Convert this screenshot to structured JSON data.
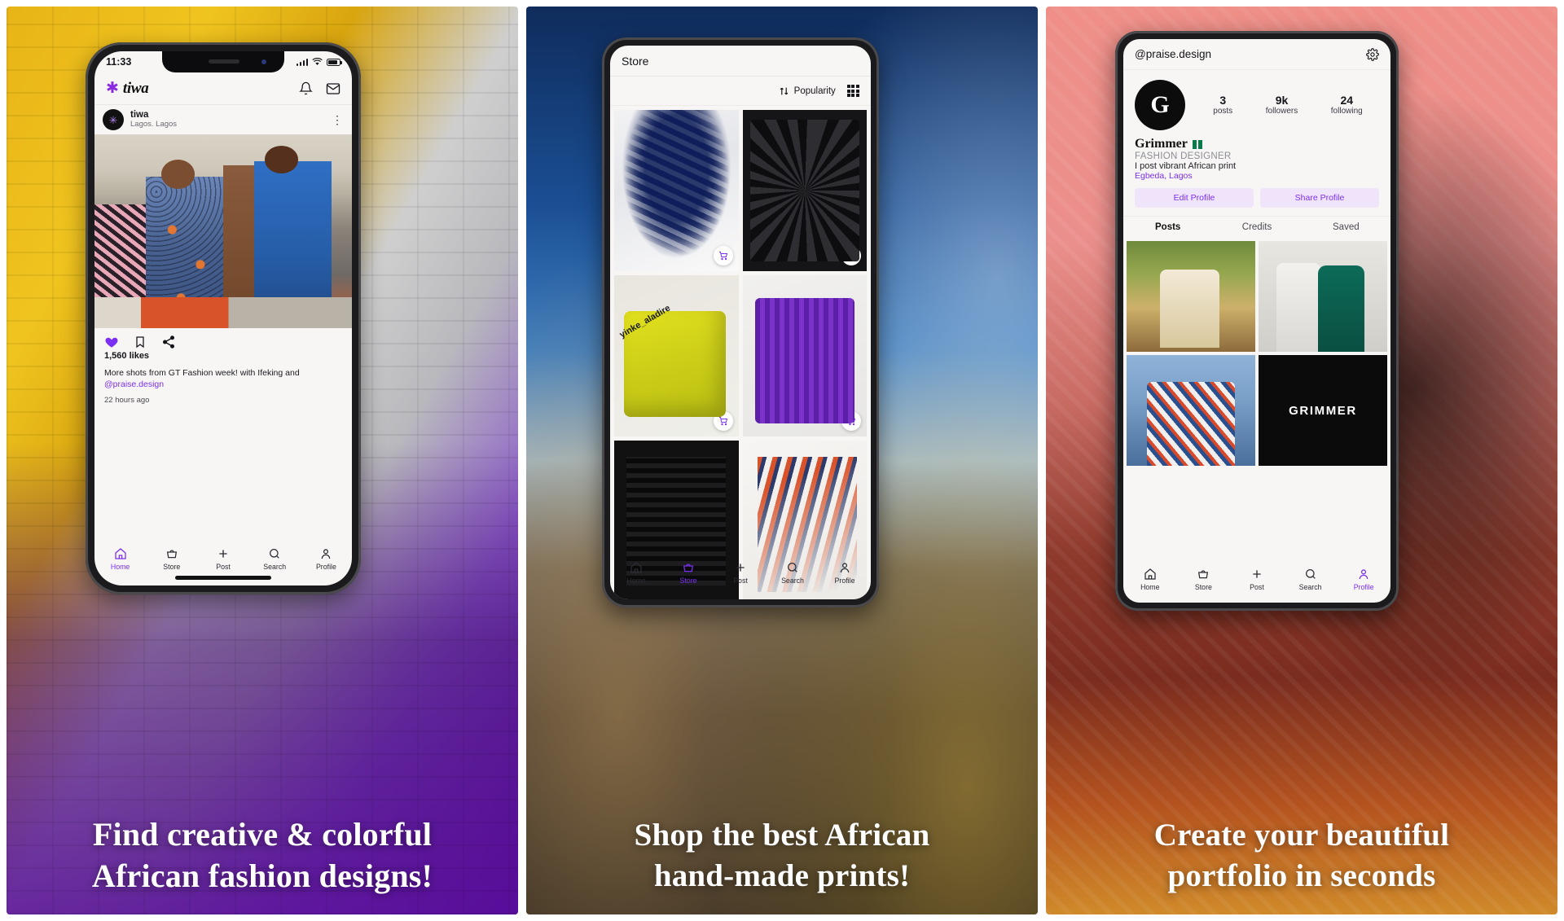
{
  "app": {
    "name": "tiwa",
    "brand_color": "#7b2ff2"
  },
  "panels": [
    {
      "caption_line1": "Find creative & colorful",
      "caption_line2": "African fashion designs!",
      "phone": {
        "status": {
          "time": "11:33"
        },
        "appbar": {
          "brand": "tiwa",
          "bell_icon": "bell-icon",
          "mail_icon": "mail-icon"
        },
        "post": {
          "author": "tiwa",
          "location": "Lagos. Lagos",
          "avatar_letter": "✳",
          "menu_icon": "more-vertical-icon",
          "likes": "1,560 likes",
          "caption": "More shots from GT Fashion week! with Ifeking and",
          "mention": "@praise.design",
          "timestamp": "22 hours ago"
        },
        "nav": [
          {
            "label": "Home",
            "icon": "home-icon",
            "active": true
          },
          {
            "label": "Store",
            "icon": "basket-icon",
            "active": false
          },
          {
            "label": "Post",
            "icon": "plus-icon",
            "active": false
          },
          {
            "label": "Search",
            "icon": "search-icon",
            "active": false
          },
          {
            "label": "Profile",
            "icon": "person-icon",
            "active": false
          }
        ]
      }
    },
    {
      "caption_line1": "Shop the best African",
      "caption_line2": "hand-made prints!",
      "phone": {
        "title": "Store",
        "sort_label": "Popularity",
        "sort_icon": "sort-arrows-icon",
        "grid_icon": "grid-view-icon",
        "products": [
          {
            "name": "navy-tie-dye-shirt",
            "cart_icon": "cart-icon"
          },
          {
            "name": "black-print-tee",
            "cart_icon": "cart-icon"
          },
          {
            "name": "yellow-adire-shirt",
            "watermark": "yinke_aladire",
            "cart_icon": "cart-icon"
          },
          {
            "name": "purple-print-shirt",
            "cart_icon": "cart-icon"
          },
          {
            "name": "black-embroidered-top",
            "cart_icon": "cart-icon"
          },
          {
            "name": "orange-tie-dye-fabric",
            "cart_icon": "cart-icon"
          }
        ],
        "nav": [
          {
            "label": "Home",
            "icon": "home-icon",
            "active": false
          },
          {
            "label": "Store",
            "icon": "basket-icon",
            "active": true
          },
          {
            "label": "Post",
            "icon": "plus-icon",
            "active": false
          },
          {
            "label": "Search",
            "icon": "search-icon",
            "active": false
          },
          {
            "label": "Profile",
            "icon": "person-icon",
            "active": false
          }
        ]
      }
    },
    {
      "caption_line1": "Create your beautiful",
      "caption_line2": "portfolio in seconds",
      "phone": {
        "handle": "@praise.design",
        "settings_icon": "gear-icon",
        "avatar_letter": "G",
        "stats": [
          {
            "num": "3",
            "label": "posts"
          },
          {
            "num": "9k",
            "label": "followers"
          },
          {
            "num": "24",
            "label": "following"
          }
        ],
        "bio": {
          "name": "Grimmer",
          "flag": "nigeria-flag",
          "role": "FASHION DESIGNER",
          "text": "I post vibrant African print",
          "location": "Egbeda, Lagos"
        },
        "buttons": [
          {
            "label": "Edit Profile"
          },
          {
            "label": "Share Profile"
          }
        ],
        "tabs": [
          {
            "label": "Posts",
            "active": true
          },
          {
            "label": "Credits",
            "active": false
          },
          {
            "label": "Saved",
            "active": false
          }
        ],
        "gallery": [
          {
            "name": "post-thumb-1"
          },
          {
            "name": "post-thumb-2"
          },
          {
            "name": "post-thumb-3"
          },
          {
            "name": "post-thumb-4",
            "wordmark": "GRIMMER"
          }
        ],
        "nav": [
          {
            "label": "Home",
            "icon": "home-icon",
            "active": false
          },
          {
            "label": "Store",
            "icon": "basket-icon",
            "active": false
          },
          {
            "label": "Post",
            "icon": "plus-icon",
            "active": false
          },
          {
            "label": "Search",
            "icon": "search-icon",
            "active": false
          },
          {
            "label": "Profile",
            "icon": "person-icon",
            "active": true
          }
        ]
      }
    }
  ]
}
